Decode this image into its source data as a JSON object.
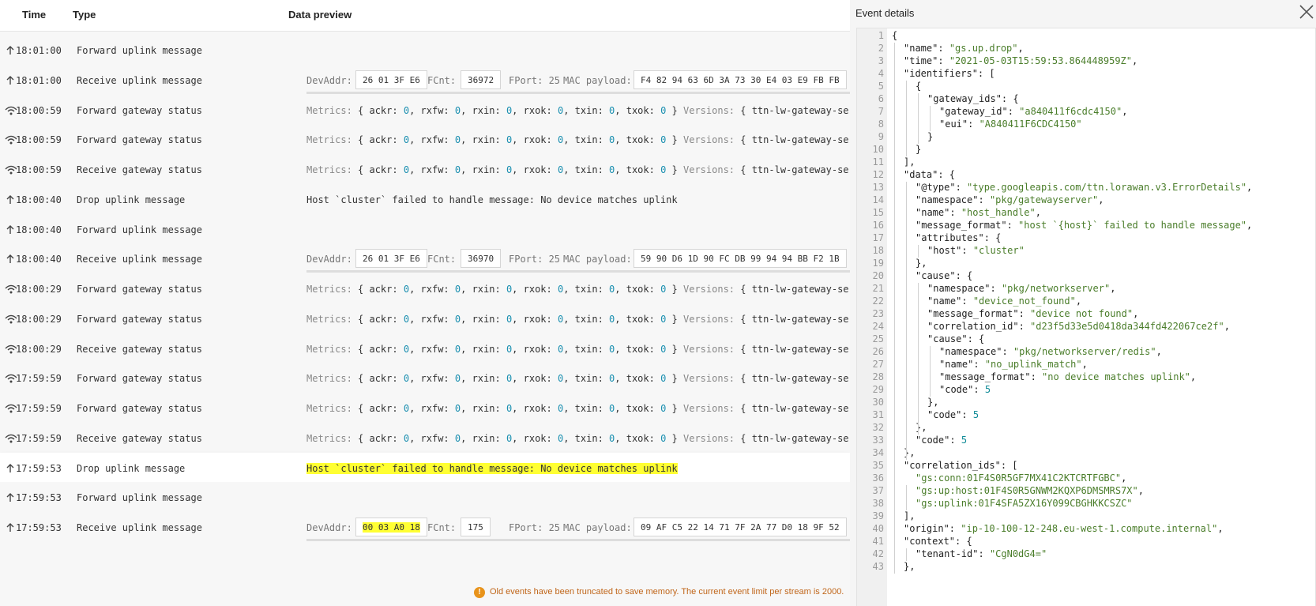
{
  "table": {
    "headers": {
      "time": "Time",
      "type": "Type",
      "data_preview": "Data preview"
    },
    "rows": [
      {
        "time": "18:01:00",
        "type": "Forward uplink message",
        "icon": "arrow-up-icon",
        "preview": "none"
      },
      {
        "time": "18:01:00",
        "type": "Receive uplink message",
        "icon": "arrow-up-icon",
        "preview": "uplink",
        "devaddr_label": "DevAddr:",
        "devaddr": "26 01 3F E6",
        "fcnt_label": "FCnt:",
        "fcnt": "36972",
        "fport": "FPort: 25",
        "mac_label": "MAC payload:",
        "mac": "F4 82 94 63 6D 3A 73 30 E4 03 E9 FB FB"
      },
      {
        "time": "18:00:59",
        "type": "Forward gateway status",
        "icon": "gateway-icon",
        "preview": "metrics"
      },
      {
        "time": "18:00:59",
        "type": "Forward gateway status",
        "icon": "gateway-icon",
        "preview": "metrics"
      },
      {
        "time": "18:00:59",
        "type": "Receive gateway status",
        "icon": "gateway-icon",
        "preview": "metrics"
      },
      {
        "time": "18:00:40",
        "type": "Drop uplink message",
        "icon": "arrow-up-icon",
        "preview": "text",
        "text": "Host `cluster` failed to handle message: No device matches uplink"
      },
      {
        "time": "18:00:40",
        "type": "Forward uplink message",
        "icon": "arrow-up-icon",
        "preview": "none"
      },
      {
        "time": "18:00:40",
        "type": "Receive uplink message",
        "icon": "arrow-up-icon",
        "preview": "uplink",
        "devaddr_label": "DevAddr:",
        "devaddr": "26 01 3F E6",
        "fcnt_label": "FCnt:",
        "fcnt": "36970",
        "fport": "FPort: 25",
        "mac_label": "MAC payload:",
        "mac": "59 90 D6 1D 90 FC DB 99 94 94 BB F2 1B"
      },
      {
        "time": "18:00:29",
        "type": "Forward gateway status",
        "icon": "gateway-icon",
        "preview": "metrics"
      },
      {
        "time": "18:00:29",
        "type": "Forward gateway status",
        "icon": "gateway-icon",
        "preview": "metrics"
      },
      {
        "time": "18:00:29",
        "type": "Receive gateway status",
        "icon": "gateway-icon",
        "preview": "metrics"
      },
      {
        "time": "17:59:59",
        "type": "Forward gateway status",
        "icon": "gateway-icon",
        "preview": "metrics"
      },
      {
        "time": "17:59:59",
        "type": "Forward gateway status",
        "icon": "gateway-icon",
        "preview": "metrics"
      },
      {
        "time": "17:59:59",
        "type": "Receive gateway status",
        "icon": "gateway-icon",
        "preview": "metrics"
      },
      {
        "time": "17:59:53",
        "type": "Drop uplink message",
        "icon": "arrow-up-icon",
        "preview": "text",
        "text": "Host `cluster` failed to handle message: No device matches uplink",
        "selected": true,
        "highlight": true
      },
      {
        "time": "17:59:53",
        "type": "Forward uplink message",
        "icon": "arrow-up-icon",
        "preview": "none"
      },
      {
        "time": "17:59:53",
        "type": "Receive uplink message",
        "icon": "arrow-up-icon",
        "preview": "uplink",
        "highlight_devaddr": true,
        "devaddr_label": "DevAddr:",
        "devaddr": "00 03 A0 18",
        "fcnt_label": "FCnt:",
        "fcnt": "175",
        "fport": "FPort: 25",
        "mac_label": "MAC payload:",
        "mac": "09 AF C5 22 14 71 7F 2A 77 D0 18 9F 52"
      }
    ],
    "metrics": {
      "metrics_label": "Metrics:",
      "open": "{",
      "pairs": [
        [
          "ackr:",
          "0"
        ],
        [
          "rxfw:",
          "0"
        ],
        [
          "rxin:",
          "0"
        ],
        [
          "rxok:",
          "0"
        ],
        [
          "txin:",
          "0"
        ],
        [
          "txok:",
          "0"
        ]
      ],
      "close": "}",
      "versions_label": "Versions:",
      "versions_value": "{ ttn-lw-gateway-ser"
    }
  },
  "footer": {
    "text": "Old events have been truncated to save memory. The current event limit per stream is 2000.",
    "icon": "warning-icon"
  },
  "details": {
    "title": "Event details",
    "close_icon": "close-icon",
    "lines": [
      [
        0,
        [
          [
            "p",
            "{"
          ]
        ]
      ],
      [
        1,
        [
          [
            "k",
            "\"name\""
          ],
          [
            "p",
            ": "
          ],
          [
            "s",
            "\"gs.up.drop\""
          ],
          [
            "p",
            ","
          ]
        ]
      ],
      [
        1,
        [
          [
            "k",
            "\"time\""
          ],
          [
            "p",
            ": "
          ],
          [
            "s",
            "\"2021-05-03T15:59:53.864448959Z\""
          ],
          [
            "p",
            ","
          ]
        ]
      ],
      [
        1,
        [
          [
            "k",
            "\"identifiers\""
          ],
          [
            "p",
            ": ["
          ]
        ]
      ],
      [
        2,
        [
          [
            "p",
            "{"
          ]
        ]
      ],
      [
        3,
        [
          [
            "k",
            "\"gateway_ids\""
          ],
          [
            "p",
            ": {"
          ]
        ]
      ],
      [
        4,
        [
          [
            "k",
            "\"gateway_id\""
          ],
          [
            "p",
            ": "
          ],
          [
            "s",
            "\"a840411f6cdc4150\""
          ],
          [
            "p",
            ","
          ]
        ]
      ],
      [
        4,
        [
          [
            "k",
            "\"eui\""
          ],
          [
            "p",
            ": "
          ],
          [
            "s",
            "\"A840411F6CDC4150\""
          ]
        ]
      ],
      [
        3,
        [
          [
            "p",
            "}"
          ]
        ]
      ],
      [
        2,
        [
          [
            "p",
            "}"
          ]
        ]
      ],
      [
        1,
        [
          [
            "p",
            "],"
          ]
        ]
      ],
      [
        1,
        [
          [
            "k",
            "\"data\""
          ],
          [
            "p",
            ": {"
          ]
        ]
      ],
      [
        2,
        [
          [
            "k",
            "\"@type\""
          ],
          [
            "p",
            ": "
          ],
          [
            "s",
            "\"type.googleapis.com/ttn.lorawan.v3.ErrorDetails\""
          ],
          [
            "p",
            ","
          ]
        ]
      ],
      [
        2,
        [
          [
            "k",
            "\"namespace\""
          ],
          [
            "p",
            ": "
          ],
          [
            "s",
            "\"pkg/gatewayserver\""
          ],
          [
            "p",
            ","
          ]
        ]
      ],
      [
        2,
        [
          [
            "k",
            "\"name\""
          ],
          [
            "p",
            ": "
          ],
          [
            "s",
            "\"host_handle\""
          ],
          [
            "p",
            ","
          ]
        ]
      ],
      [
        2,
        [
          [
            "k",
            "\"message_format\""
          ],
          [
            "p",
            ": "
          ],
          [
            "s",
            "\"host `{host}` failed to handle message\""
          ],
          [
            "p",
            ","
          ]
        ]
      ],
      [
        2,
        [
          [
            "k",
            "\"attributes\""
          ],
          [
            "p",
            ": {"
          ]
        ]
      ],
      [
        3,
        [
          [
            "k",
            "\"host\""
          ],
          [
            "p",
            ": "
          ],
          [
            "s",
            "\"cluster\""
          ]
        ]
      ],
      [
        2,
        [
          [
            "p",
            "},"
          ]
        ]
      ],
      [
        2,
        [
          [
            "k",
            "\"cause\""
          ],
          [
            "p",
            ": {"
          ]
        ]
      ],
      [
        3,
        [
          [
            "k",
            "\"namespace\""
          ],
          [
            "p",
            ": "
          ],
          [
            "s",
            "\"pkg/networkserver\""
          ],
          [
            "p",
            ","
          ]
        ]
      ],
      [
        3,
        [
          [
            "k",
            "\"name\""
          ],
          [
            "p",
            ": "
          ],
          [
            "s",
            "\"device_not_found\""
          ],
          [
            "p",
            ","
          ]
        ]
      ],
      [
        3,
        [
          [
            "k",
            "\"message_format\""
          ],
          [
            "p",
            ": "
          ],
          [
            "s",
            "\"device not found\""
          ],
          [
            "p",
            ","
          ]
        ]
      ],
      [
        3,
        [
          [
            "k",
            "\"correlation_id\""
          ],
          [
            "p",
            ": "
          ],
          [
            "s",
            "\"d23f5d33e5d0418da344fd422067ce2f\""
          ],
          [
            "p",
            ","
          ]
        ]
      ],
      [
        3,
        [
          [
            "k",
            "\"cause\""
          ],
          [
            "p",
            ": {"
          ]
        ]
      ],
      [
        4,
        [
          [
            "k",
            "\"namespace\""
          ],
          [
            "p",
            ": "
          ],
          [
            "s",
            "\"pkg/networkserver/redis\""
          ],
          [
            "p",
            ","
          ]
        ]
      ],
      [
        4,
        [
          [
            "k",
            "\"name\""
          ],
          [
            "p",
            ": "
          ],
          [
            "s",
            "\"no_uplink_match\""
          ],
          [
            "p",
            ","
          ]
        ]
      ],
      [
        4,
        [
          [
            "k",
            "\"message_format\""
          ],
          [
            "p",
            ": "
          ],
          [
            "s",
            "\"no device matches uplink\""
          ],
          [
            "p",
            ","
          ]
        ]
      ],
      [
        4,
        [
          [
            "k",
            "\"code\""
          ],
          [
            "p",
            ": "
          ],
          [
            "n",
            "5"
          ]
        ]
      ],
      [
        3,
        [
          [
            "p",
            "},"
          ]
        ]
      ],
      [
        3,
        [
          [
            "k",
            "\"code\""
          ],
          [
            "p",
            ": "
          ],
          [
            "n",
            "5"
          ]
        ]
      ],
      [
        2,
        [
          [
            "p",
            "},"
          ]
        ]
      ],
      [
        2,
        [
          [
            "k",
            "\"code\""
          ],
          [
            "p",
            ": "
          ],
          [
            "n",
            "5"
          ]
        ]
      ],
      [
        1,
        [
          [
            "p",
            "},"
          ]
        ]
      ],
      [
        1,
        [
          [
            "k",
            "\"correlation_ids\""
          ],
          [
            "p",
            ": ["
          ]
        ]
      ],
      [
        2,
        [
          [
            "s",
            "\"gs:conn:01F4S0R5GF7MX41C2KTCRTFGBC\""
          ],
          [
            "p",
            ","
          ]
        ]
      ],
      [
        2,
        [
          [
            "s",
            "\"gs:up:host:01F4S0R5GNWM2KQXP6DMSMRS7X\""
          ],
          [
            "p",
            ","
          ]
        ]
      ],
      [
        2,
        [
          [
            "s",
            "\"gs:uplink:01F4SFA5ZX16Y099CBGHKKCSZC\""
          ]
        ]
      ],
      [
        1,
        [
          [
            "p",
            "],"
          ]
        ]
      ],
      [
        1,
        [
          [
            "k",
            "\"origin\""
          ],
          [
            "p",
            ": "
          ],
          [
            "s",
            "\"ip-10-100-12-248.eu-west-1.compute.internal\""
          ],
          [
            "p",
            ","
          ]
        ]
      ],
      [
        1,
        [
          [
            "k",
            "\"context\""
          ],
          [
            "p",
            ": {"
          ]
        ]
      ],
      [
        2,
        [
          [
            "k",
            "\"tenant-id\""
          ],
          [
            "p",
            ": "
          ],
          [
            "s",
            "\"CgN0dG4=\""
          ]
        ]
      ],
      [
        1,
        [
          [
            "p",
            "},"
          ]
        ]
      ]
    ]
  }
}
